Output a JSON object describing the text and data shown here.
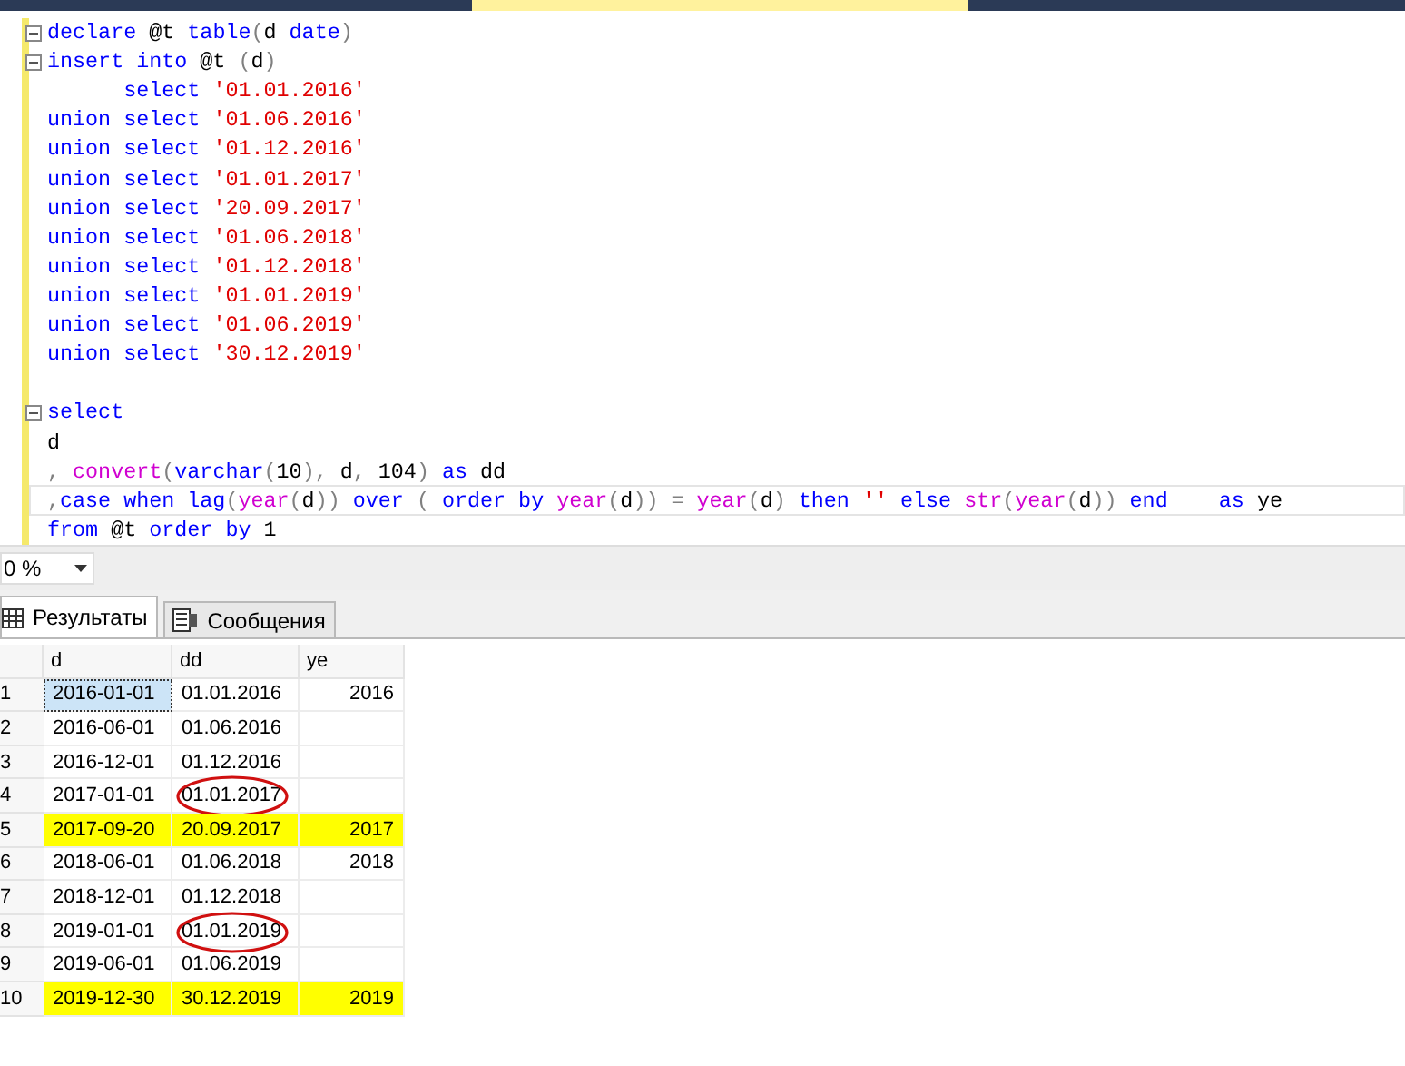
{
  "editor": {
    "lines": [
      {
        "fold": true,
        "current": false,
        "tokens": [
          {
            "text": "declare",
            "kind": "keyword"
          },
          {
            "text": " @t ",
            "kind": "plain"
          },
          {
            "text": "table",
            "kind": "keyword"
          },
          {
            "text": "(",
            "kind": "gray"
          },
          {
            "text": "d ",
            "kind": "plain"
          },
          {
            "text": "date",
            "kind": "keyword"
          },
          {
            "text": ")",
            "kind": "gray"
          }
        ]
      },
      {
        "fold": true,
        "current": false,
        "tokens": [
          {
            "text": "insert into",
            "kind": "keyword"
          },
          {
            "text": " @t ",
            "kind": "plain"
          },
          {
            "text": "(",
            "kind": "gray"
          },
          {
            "text": "d",
            "kind": "plain"
          },
          {
            "text": ")",
            "kind": "gray"
          }
        ]
      },
      {
        "fold": false,
        "current": false,
        "tokens": [
          {
            "text": "      select ",
            "kind": "keyword"
          },
          {
            "text": "'01.01.2016'",
            "kind": "string"
          }
        ]
      },
      {
        "fold": false,
        "current": false,
        "tokens": [
          {
            "text": "union select ",
            "kind": "keyword"
          },
          {
            "text": "'01.06.2016'",
            "kind": "string"
          }
        ]
      },
      {
        "fold": false,
        "current": false,
        "tokens": [
          {
            "text": "union select ",
            "kind": "keyword"
          },
          {
            "text": "'01.12.2016'",
            "kind": "string"
          }
        ]
      },
      {
        "fold": false,
        "current": false,
        "tokens": [
          {
            "text": "union select ",
            "kind": "keyword"
          },
          {
            "text": "'01.01.2017'",
            "kind": "string"
          }
        ]
      },
      {
        "fold": false,
        "current": false,
        "tokens": [
          {
            "text": "union select ",
            "kind": "keyword"
          },
          {
            "text": "'20.09.2017'",
            "kind": "string"
          }
        ]
      },
      {
        "fold": false,
        "current": false,
        "tokens": [
          {
            "text": "union select ",
            "kind": "keyword"
          },
          {
            "text": "'01.06.2018'",
            "kind": "string"
          }
        ]
      },
      {
        "fold": false,
        "current": false,
        "tokens": [
          {
            "text": "union select ",
            "kind": "keyword"
          },
          {
            "text": "'01.12.2018'",
            "kind": "string"
          }
        ]
      },
      {
        "fold": false,
        "current": false,
        "tokens": [
          {
            "text": "union select ",
            "kind": "keyword"
          },
          {
            "text": "'01.01.2019'",
            "kind": "string"
          }
        ]
      },
      {
        "fold": false,
        "current": false,
        "tokens": [
          {
            "text": "union select ",
            "kind": "keyword"
          },
          {
            "text": "'01.06.2019'",
            "kind": "string"
          }
        ]
      },
      {
        "fold": false,
        "current": false,
        "tokens": [
          {
            "text": "union select ",
            "kind": "keyword"
          },
          {
            "text": "'30.12.2019'",
            "kind": "string"
          }
        ]
      },
      {
        "fold": false,
        "current": false
      },
      {
        "fold": true,
        "current": false,
        "tokens": [
          {
            "text": "select",
            "kind": "keyword"
          }
        ]
      },
      {
        "fold": false,
        "current": false,
        "tokens": [
          {
            "text": "d",
            "kind": "plain"
          }
        ]
      },
      {
        "fold": false,
        "current": false,
        "tokens": [
          {
            "text": ", ",
            "kind": "gray"
          },
          {
            "text": "convert",
            "kind": "function"
          },
          {
            "text": "(",
            "kind": "gray"
          },
          {
            "text": "varchar",
            "kind": "keyword"
          },
          {
            "text": "(",
            "kind": "gray"
          },
          {
            "text": "10",
            "kind": "plain"
          },
          {
            "text": "), ",
            "kind": "gray"
          },
          {
            "text": "d",
            "kind": "plain"
          },
          {
            "text": ", ",
            "kind": "gray"
          },
          {
            "text": "104",
            "kind": "plain"
          },
          {
            "text": ") ",
            "kind": "gray"
          },
          {
            "text": "as",
            "kind": "keyword"
          },
          {
            "text": " dd",
            "kind": "plain"
          }
        ]
      },
      {
        "fold": false,
        "current": true,
        "tokens": [
          {
            "text": ",",
            "kind": "gray"
          },
          {
            "text": "case when ",
            "kind": "keyword"
          },
          {
            "text": "lag",
            "kind": "keyword"
          },
          {
            "text": "(",
            "kind": "gray"
          },
          {
            "text": "year",
            "kind": "function"
          },
          {
            "text": "(",
            "kind": "gray"
          },
          {
            "text": "d",
            "kind": "plain"
          },
          {
            "text": ")) ",
            "kind": "gray"
          },
          {
            "text": "over ",
            "kind": "keyword"
          },
          {
            "text": "( ",
            "kind": "gray"
          },
          {
            "text": "order by ",
            "kind": "keyword"
          },
          {
            "text": "year",
            "kind": "function"
          },
          {
            "text": "(",
            "kind": "gray"
          },
          {
            "text": "d",
            "kind": "plain"
          },
          {
            "text": ")) = ",
            "kind": "gray"
          },
          {
            "text": "year",
            "kind": "function"
          },
          {
            "text": "(",
            "kind": "gray"
          },
          {
            "text": "d",
            "kind": "plain"
          },
          {
            "text": ") ",
            "kind": "gray"
          },
          {
            "text": "then ",
            "kind": "keyword"
          },
          {
            "text": "'' ",
            "kind": "string"
          },
          {
            "text": "else ",
            "kind": "keyword"
          },
          {
            "text": "str",
            "kind": "function"
          },
          {
            "text": "(",
            "kind": "gray"
          },
          {
            "text": "year",
            "kind": "function"
          },
          {
            "text": "(",
            "kind": "gray"
          },
          {
            "text": "d",
            "kind": "plain"
          },
          {
            "text": ")) ",
            "kind": "gray"
          },
          {
            "text": "end",
            "kind": "keyword"
          },
          {
            "text": "    as",
            "kind": "keyword"
          },
          {
            "text": " ye",
            "kind": "plain"
          }
        ]
      },
      {
        "fold": false,
        "current": false,
        "tokens": [
          {
            "text": "from",
            "kind": "keyword"
          },
          {
            "text": " @t ",
            "kind": "plain"
          },
          {
            "text": "order by ",
            "kind": "keyword"
          },
          {
            "text": "1",
            "kind": "plain"
          }
        ]
      }
    ]
  },
  "zoom": {
    "value": "0 %"
  },
  "result_tabs": [
    {
      "label": "Результаты",
      "selected": true
    },
    {
      "label": "Сообщения",
      "selected": false
    }
  ],
  "table": {
    "columns": [
      "d",
      "dd",
      "ye"
    ],
    "rows": [
      {
        "num": "1",
        "cells": [
          "2016-01-01",
          "01.01.2016",
          "2016"
        ],
        "selected_cell": true,
        "highlighted": false,
        "circled": false
      },
      {
        "num": "2",
        "cells": [
          "2016-06-01",
          "01.06.2016",
          ""
        ],
        "selected_cell": false,
        "highlighted": false,
        "circled": false
      },
      {
        "num": "3",
        "cells": [
          "2016-12-01",
          "01.12.2016",
          ""
        ],
        "selected_cell": false,
        "highlighted": false,
        "circled": false
      },
      {
        "num": "4",
        "cells": [
          "2017-01-01",
          "01.01.2017",
          ""
        ],
        "selected_cell": false,
        "highlighted": false,
        "circled": true
      },
      {
        "num": "5",
        "cells": [
          "2017-09-20",
          "20.09.2017",
          "2017"
        ],
        "selected_cell": false,
        "highlighted": true,
        "circled": false
      },
      {
        "num": "6",
        "cells": [
          "2018-06-01",
          "01.06.2018",
          "2018"
        ],
        "selected_cell": false,
        "highlighted": false,
        "circled": false
      },
      {
        "num": "7",
        "cells": [
          "2018-12-01",
          "01.12.2018",
          ""
        ],
        "selected_cell": false,
        "highlighted": false,
        "circled": false
      },
      {
        "num": "8",
        "cells": [
          "2019-01-01",
          "01.01.2019",
          ""
        ],
        "selected_cell": false,
        "highlighted": false,
        "circled": true
      },
      {
        "num": "9",
        "cells": [
          "2019-06-01",
          "01.06.2019",
          ""
        ],
        "selected_cell": false,
        "highlighted": false,
        "circled": false
      },
      {
        "num": "10",
        "cells": [
          "2019-12-30",
          "30.12.2019",
          "2019"
        ],
        "selected_cell": false,
        "highlighted": true,
        "circled": false
      }
    ]
  }
}
